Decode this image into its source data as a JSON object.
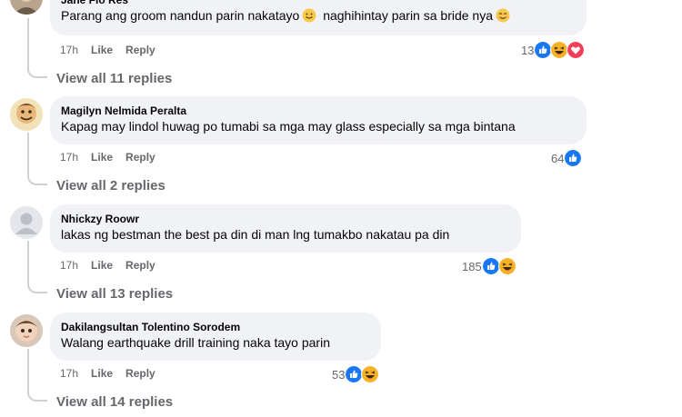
{
  "comments": [
    {
      "author": "Jane Flo Res",
      "text_a": "Parang ang groom nandun parin nakatayo",
      "text_b": "naghihintay parin sa bride nya",
      "emoji_a": "slight-smile-emoji",
      "emoji_b": "smile-emoji",
      "time": "17h",
      "like": "Like",
      "reply": "Reply",
      "reaction_count": "13",
      "reaction_icons": [
        "like",
        "haha",
        "love"
      ],
      "view_replies": "View all 11 replies"
    },
    {
      "author": "Magilyn Nelmida Peralta",
      "text": "Kapag may lindol huwag po tumabi sa mga may glass especially sa mga bintana",
      "time": "17h",
      "like": "Like",
      "reply": "Reply",
      "reaction_count": "64",
      "reaction_icons": [
        "like"
      ],
      "view_replies": "View all 2 replies"
    },
    {
      "author": "Nhickzy Roowr",
      "text": "lakas ng bestman the best pa din di man lng tumakbo nakatau pa din",
      "time": "17h",
      "like": "Like",
      "reply": "Reply",
      "reaction_count": "185",
      "reaction_icons": [
        "like",
        "haha"
      ],
      "view_replies": "View all 13 replies"
    },
    {
      "author": "Dakilangsultan Tolentino Sorodem",
      "text": "Walang earthquake drill training naka tayo parin",
      "time": "17h",
      "like": "Like",
      "reply": "Reply",
      "reaction_count": "53",
      "reaction_icons": [
        "like",
        "haha"
      ],
      "view_replies": "View all 14 replies"
    }
  ],
  "colors": {
    "bubble": "#f0f2f5",
    "meta_text": "#65676b",
    "like_blue": "#1877f2",
    "love_red": "#f33e58",
    "haha_yellow": "#f7b125"
  }
}
